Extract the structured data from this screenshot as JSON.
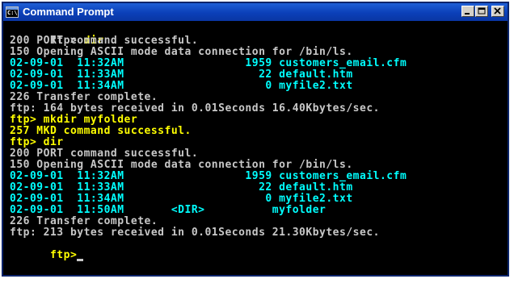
{
  "window": {
    "title": "Command Prompt",
    "icon": "console-icon",
    "icon_text": "C:\\",
    "controls": [
      "minimize-icon",
      "maximize-icon",
      "close-icon"
    ],
    "title_color": "#0a36a3"
  },
  "colors": {
    "background": "#000000",
    "normal_text": "#c8c8c8",
    "command_text": "#ffff00",
    "listing_text": "#00ffff"
  },
  "console": {
    "lines": [
      {
        "text": "ftp> ",
        "cmd": "dir",
        "color": "white+yellow"
      },
      {
        "text": "200 PORT command successful.",
        "color": "white"
      },
      {
        "text": "150 Opening ASCII mode data connection for /bin/ls.",
        "color": "white"
      },
      {
        "text": "02-09-01  11:32AM                  1959 customers_email.cfm",
        "color": "cyan"
      },
      {
        "text": "02-09-01  11:33AM                    22 default.htm",
        "color": "cyan"
      },
      {
        "text": "02-09-01  11:34AM                     0 myfile2.txt",
        "color": "cyan"
      },
      {
        "text": "226 Transfer complete.",
        "color": "white"
      },
      {
        "text": "ftp: 164 bytes received in 0.01Seconds 16.40Kbytes/sec.",
        "color": "white"
      },
      {
        "text": "ftp> mkdir myfolder",
        "color": "yellow"
      },
      {
        "text": "257 MKD command successful.",
        "color": "yellow"
      },
      {
        "text": "ftp> dir",
        "color": "yellow"
      },
      {
        "text": "200 PORT command successful.",
        "color": "white"
      },
      {
        "text": "150 Opening ASCII mode data connection for /bin/ls.",
        "color": "white"
      },
      {
        "text": "02-09-01  11:32AM                  1959 customers_email.cfm",
        "color": "cyan"
      },
      {
        "text": "02-09-01  11:33AM                    22 default.htm",
        "color": "cyan"
      },
      {
        "text": "02-09-01  11:34AM                     0 myfile2.txt",
        "color": "cyan"
      },
      {
        "text": "02-09-01  11:50AM       <DIR>          myfolder",
        "color": "cyan"
      },
      {
        "text": "226 Transfer complete.",
        "color": "white"
      },
      {
        "text": "ftp: 213 bytes received in 0.01Seconds 21.30Kbytes/sec.",
        "color": "white"
      },
      {
        "text": "ftp>",
        "color": "yellow"
      }
    ]
  }
}
